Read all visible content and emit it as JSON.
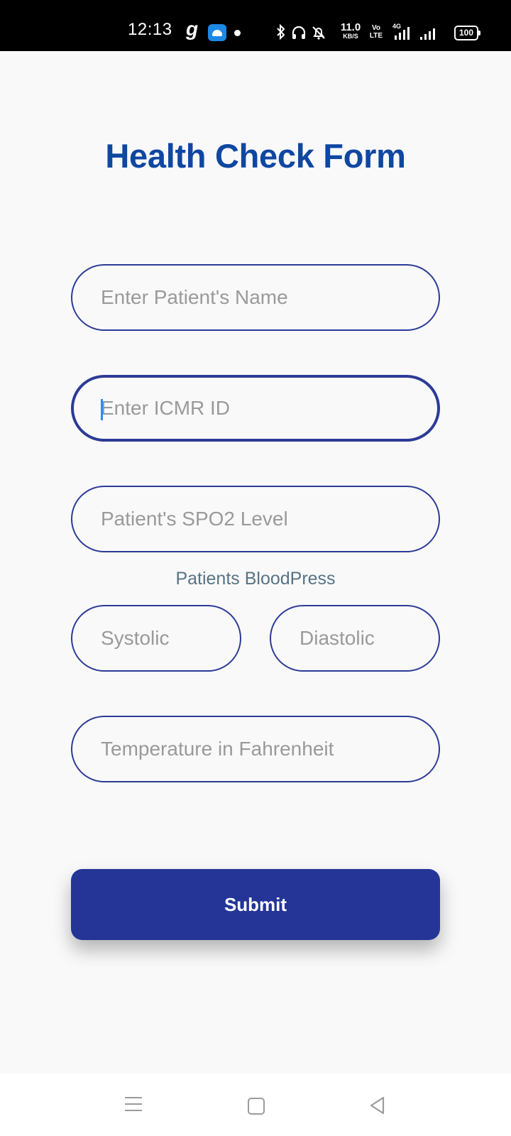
{
  "status_bar": {
    "time": "12:13",
    "carrier_glyph": "g",
    "data_speed": "11.0",
    "data_speed_unit": "KB/S",
    "volte": "Vo LTE",
    "network": "4G",
    "battery": "100"
  },
  "form": {
    "title": "Health Check Form",
    "patient_name_placeholder": "Enter Patient's Name",
    "icmr_id_placeholder": "Enter ICMR ID",
    "spo2_placeholder": "Patient's SPO2 Level",
    "blood_pressure_label": "Patients BloodPress",
    "systolic_placeholder": "Systolic",
    "diastolic_placeholder": "Diastolic",
    "temperature_placeholder": "Temperature in Fahrenheit",
    "submit_label": "Submit"
  },
  "colors": {
    "title": "#0f47a1",
    "accent": "#243597",
    "field_border": "#2b3b96",
    "label": "#577483",
    "background": "#f9f9fa"
  }
}
